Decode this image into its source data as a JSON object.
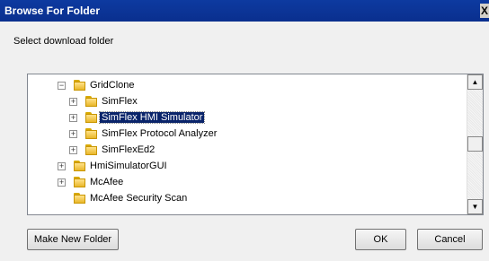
{
  "window": {
    "title": "Browse For Folder",
    "close_glyph": "X"
  },
  "prompt": "Select download folder",
  "tree": {
    "items": [
      {
        "label": "GridClone",
        "expander": "−",
        "selected": false
      },
      {
        "label": "SimFlex",
        "expander": "+",
        "selected": false
      },
      {
        "label": "SimFlex HMI Simulator",
        "expander": "+",
        "selected": true
      },
      {
        "label": "SimFlex Protocol Analyzer",
        "expander": "+",
        "selected": false
      },
      {
        "label": "SimFlexEd2",
        "expander": "+",
        "selected": false
      },
      {
        "label": "HmiSimulatorGUI",
        "expander": "+",
        "selected": false
      },
      {
        "label": "McAfee",
        "expander": "+",
        "selected": false
      },
      {
        "label": "McAfee Security Scan",
        "expander": "",
        "selected": false
      }
    ],
    "scroll_up": "▲",
    "scroll_down": "▼"
  },
  "buttons": {
    "make_new_folder": "Make New Folder",
    "ok": "OK",
    "cancel": "Cancel"
  },
  "colors": {
    "titlebar": "#0a2f8e",
    "selection": "#0a246a"
  }
}
